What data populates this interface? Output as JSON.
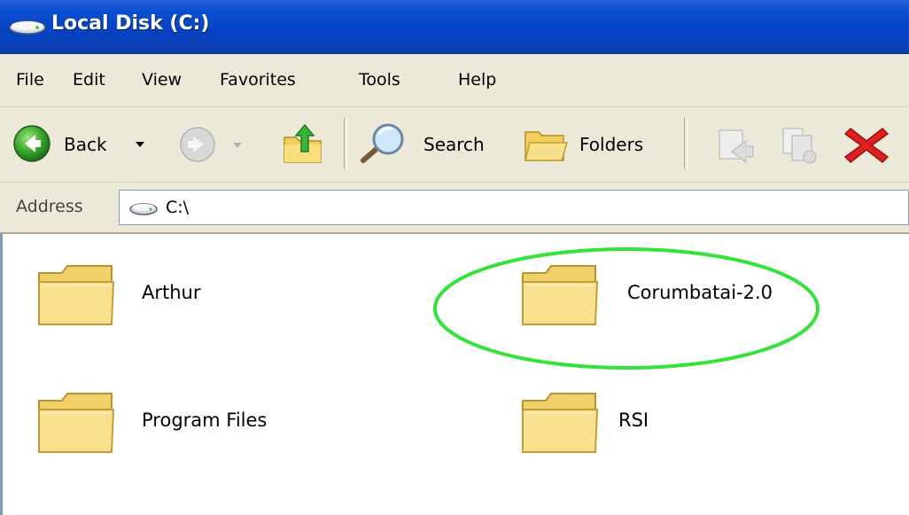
{
  "window": {
    "title": "Local Disk (C:)"
  },
  "menu": {
    "items": [
      "File",
      "Edit",
      "View",
      "Favorites",
      "Tools",
      "Help"
    ]
  },
  "toolbar": {
    "back_label": "Back",
    "search_label": "Search",
    "folders_label": "Folders"
  },
  "address": {
    "label": "Address",
    "value": "C:\\"
  },
  "items": [
    {
      "label": "Arthur"
    },
    {
      "label": "Corumbatai-2.0"
    },
    {
      "label": "Program Files"
    },
    {
      "label": "RSI"
    }
  ],
  "colors": {
    "titlebar": "#0642c2",
    "chrome": "#ece9d8",
    "folder": "#f2d46a",
    "highlight": "#33e23b",
    "delete": "#e02020"
  },
  "annotation": {
    "shape": "ellipse",
    "target": "Corumbatai-2.0",
    "color": "#33e23b"
  }
}
